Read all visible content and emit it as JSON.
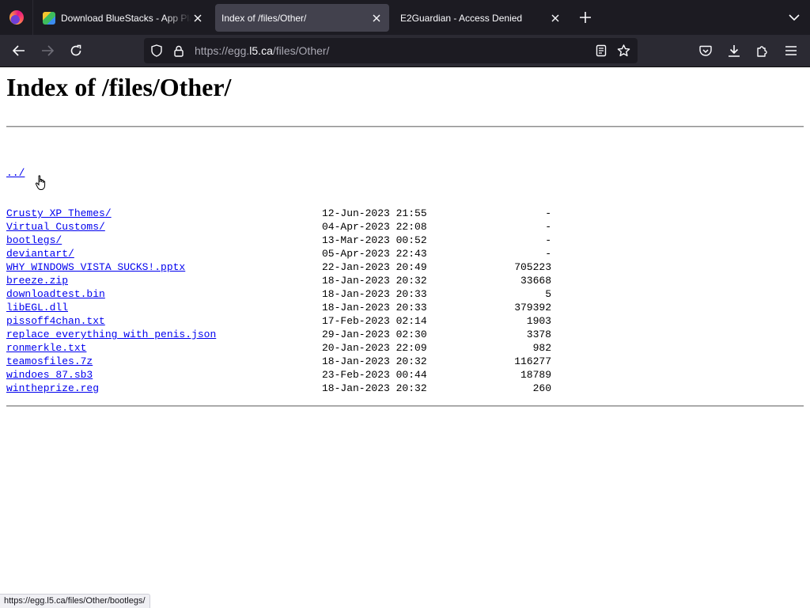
{
  "tabs": [
    {
      "title": "Download BlueStacks - App Player",
      "icon": "bluestacks-favicon",
      "active": false
    },
    {
      "title": "Index of /files/Other/",
      "active": true
    },
    {
      "title": "E2Guardian - Access Denied",
      "active": false
    }
  ],
  "navbar": {
    "url_scheme": "https://egg.",
    "url_host": "l5.ca",
    "url_path": "/files/Other/"
  },
  "page": {
    "title": "Index of /files/Other/",
    "parent_link": "../",
    "entries": [
      {
        "name": "Crusty XP Themes/",
        "date": "12-Jun-2023 21:55",
        "size": "-"
      },
      {
        "name": "Virtual Customs/",
        "date": "04-Apr-2023 22:08",
        "size": "-"
      },
      {
        "name": "bootlegs/",
        "date": "13-Mar-2023 00:52",
        "size": "-"
      },
      {
        "name": "deviantart/",
        "date": "05-Apr-2023 22:43",
        "size": "-"
      },
      {
        "name": "WHY WINDOWS VISTA SUCKS!.pptx",
        "date": "22-Jan-2023 20:49",
        "size": "705223"
      },
      {
        "name": "breeze.zip",
        "date": "18-Jan-2023 20:32",
        "size": "33668"
      },
      {
        "name": "downloadtest.bin",
        "date": "18-Jan-2023 20:33",
        "size": "5"
      },
      {
        "name": "libEGL.dll",
        "date": "18-Jan-2023 20:33",
        "size": "379392"
      },
      {
        "name": "pissoff4chan.txt",
        "date": "17-Feb-2023 02:14",
        "size": "1903"
      },
      {
        "name": "replace everything with penis.json",
        "date": "29-Jan-2023 02:30",
        "size": "3378"
      },
      {
        "name": "ronmerkle.txt",
        "date": "20-Jan-2023 22:09",
        "size": "982"
      },
      {
        "name": "teamosfiles.7z",
        "date": "18-Jan-2023 20:32",
        "size": "116277"
      },
      {
        "name": "windoes 87.sb3",
        "date": "23-Feb-2023 00:44",
        "size": "18789"
      },
      {
        "name": "wintheprize.reg",
        "date": "18-Jan-2023 20:32",
        "size": "260"
      }
    ]
  },
  "status": {
    "hover_url": "https://egg.l5.ca/files/Other/bootlegs/"
  },
  "colors": {
    "link": "#0000ee",
    "chrome_dark": "#1c1b22",
    "toolbar": "#2b2a33",
    "active_tab": "#42414d"
  }
}
